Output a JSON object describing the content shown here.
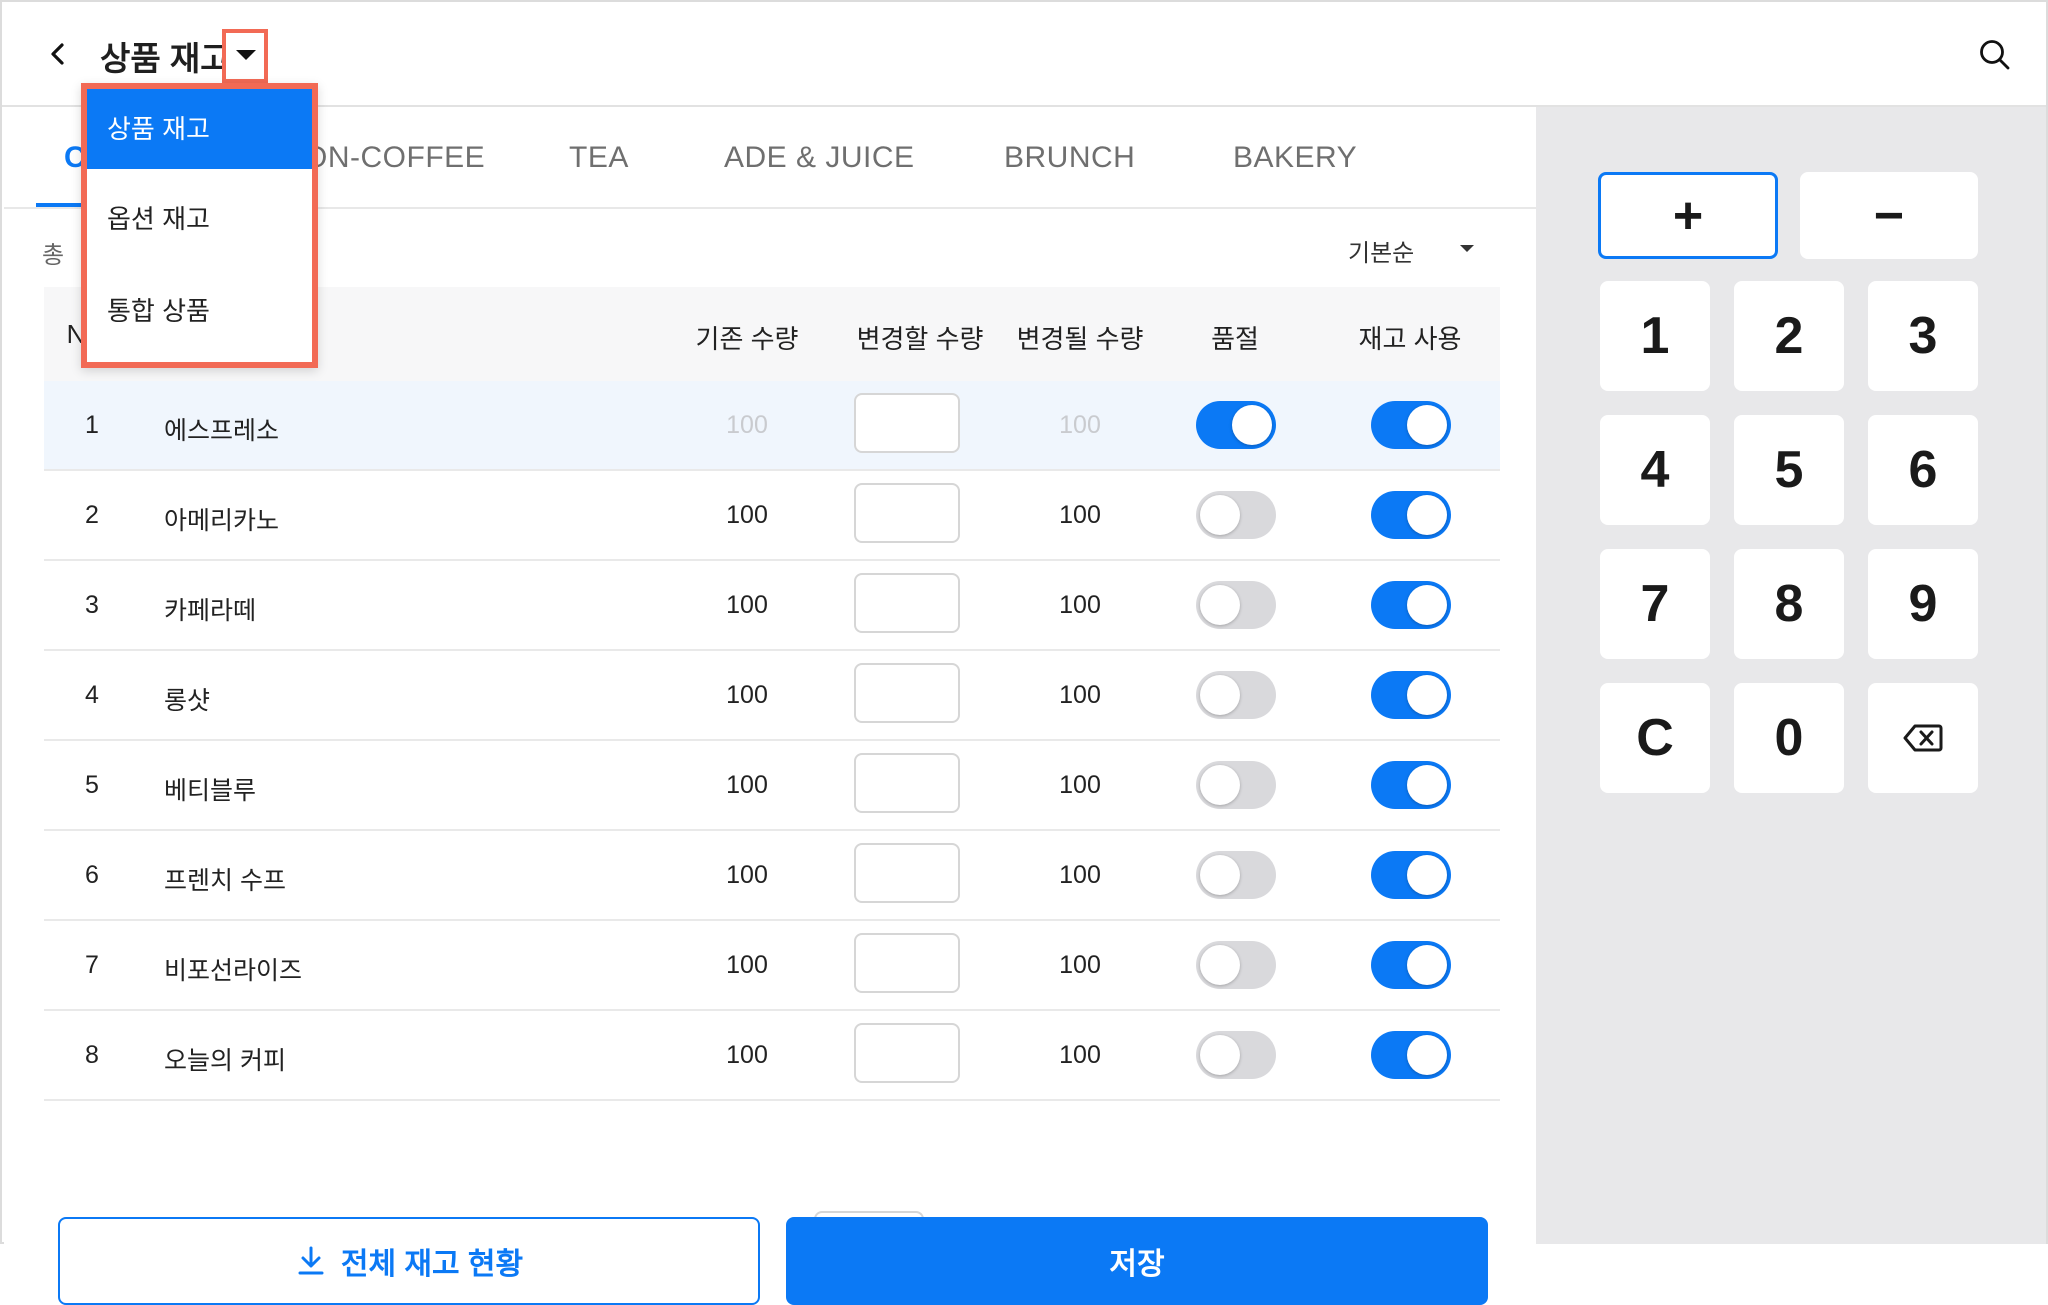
{
  "header": {
    "title": "상품 재고"
  },
  "dropdown_menu": {
    "items": [
      {
        "label": "상품 재고",
        "selected": true
      },
      {
        "label": "옵션 재고",
        "selected": false
      },
      {
        "label": "통합 상품",
        "selected": false
      }
    ]
  },
  "tabs": [
    {
      "label": "C",
      "active": true
    },
    {
      "label": "ON-COFFEE",
      "active": false
    },
    {
      "label": "TEA",
      "active": false
    },
    {
      "label": "ADE & JUICE",
      "active": false
    },
    {
      "label": "BRUNCH",
      "active": false
    },
    {
      "label": "BAKERY",
      "active": false
    }
  ],
  "list": {
    "total_label": "총",
    "sort_label": "기본순",
    "columns": {
      "no": "N",
      "current_qty": "기존 수량",
      "change_qty": "변경할 수량",
      "changed_qty": "변경될 수량",
      "soldout": "품절",
      "stock_use": "재고 사용"
    },
    "rows": [
      {
        "no": "1",
        "name": "에스프레소",
        "current": "100",
        "changed": "100",
        "soldout": true,
        "stock_use": true,
        "selected": true
      },
      {
        "no": "2",
        "name": "아메리카노",
        "current": "100",
        "changed": "100",
        "soldout": false,
        "stock_use": true,
        "selected": false
      },
      {
        "no": "3",
        "name": "카페라떼",
        "current": "100",
        "changed": "100",
        "soldout": false,
        "stock_use": true,
        "selected": false
      },
      {
        "no": "4",
        "name": "롱샷",
        "current": "100",
        "changed": "100",
        "soldout": false,
        "stock_use": true,
        "selected": false
      },
      {
        "no": "5",
        "name": "베티블루",
        "current": "100",
        "changed": "100",
        "soldout": false,
        "stock_use": true,
        "selected": false
      },
      {
        "no": "6",
        "name": "프렌치 수프",
        "current": "100",
        "changed": "100",
        "soldout": false,
        "stock_use": true,
        "selected": false
      },
      {
        "no": "7",
        "name": "비포선라이즈",
        "current": "100",
        "changed": "100",
        "soldout": false,
        "stock_use": true,
        "selected": false
      },
      {
        "no": "8",
        "name": "오늘의 커피",
        "current": "100",
        "changed": "100",
        "soldout": false,
        "stock_use": true,
        "selected": false
      }
    ]
  },
  "actions": {
    "export_label": "전체 재고 현황",
    "save_label": "저장"
  },
  "keypad": {
    "plus": "+",
    "minus": "−",
    "keys": [
      "1",
      "2",
      "3",
      "4",
      "5",
      "6",
      "7",
      "8",
      "9",
      "C",
      "0"
    ]
  },
  "colors": {
    "accent": "#0b79f5",
    "highlight": "#f26a55",
    "panel": "#e8e8ea"
  }
}
